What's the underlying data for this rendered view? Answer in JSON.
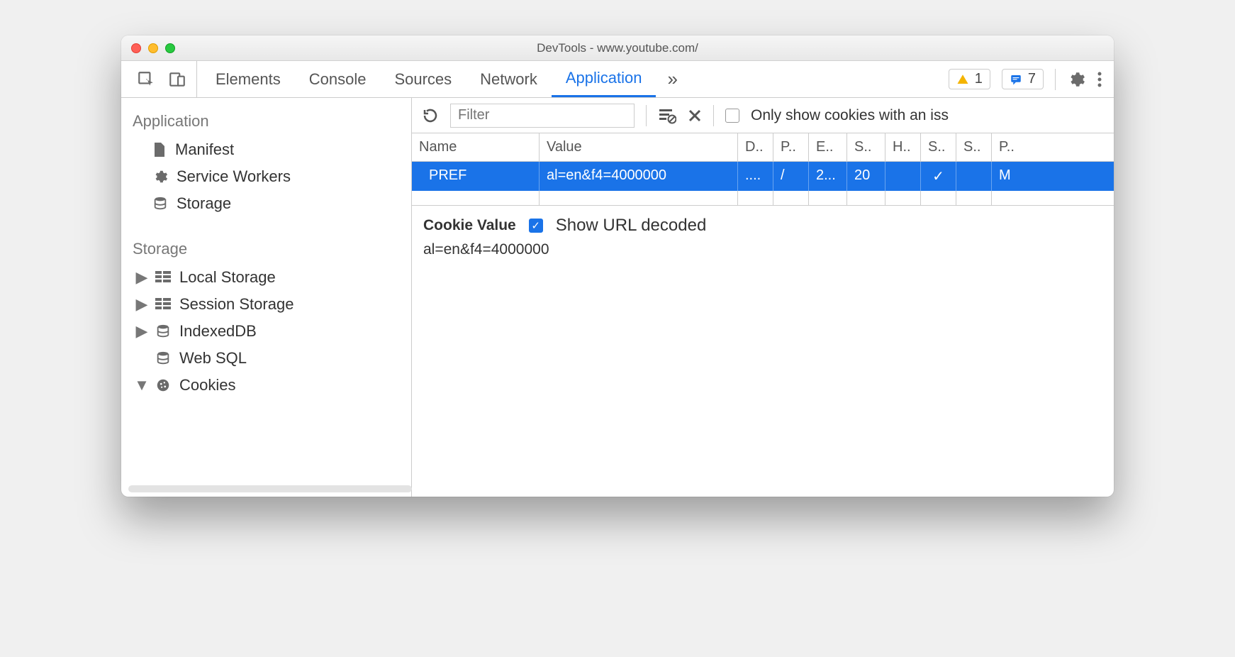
{
  "window": {
    "title": "DevTools - www.youtube.com/"
  },
  "tabs": {
    "items": [
      "Elements",
      "Console",
      "Sources",
      "Network",
      "Application"
    ],
    "active": "Application"
  },
  "counters": {
    "warnings": "1",
    "messages": "7"
  },
  "toolbar": {
    "filter_placeholder": "Filter",
    "only_issue_label": "Only show cookies with an iss"
  },
  "sidebar": {
    "sections": [
      {
        "title": "Application",
        "items": [
          {
            "label": "Manifest",
            "icon": "file"
          },
          {
            "label": "Service Workers",
            "icon": "gear"
          },
          {
            "label": "Storage",
            "icon": "db"
          }
        ]
      },
      {
        "title": "Storage",
        "items": [
          {
            "label": "Local Storage",
            "icon": "grid",
            "caret": "right"
          },
          {
            "label": "Session Storage",
            "icon": "grid",
            "caret": "right"
          },
          {
            "label": "IndexedDB",
            "icon": "db",
            "caret": "right"
          },
          {
            "label": "Web SQL",
            "icon": "db"
          },
          {
            "label": "Cookies",
            "icon": "cookie",
            "caret": "down"
          }
        ]
      }
    ]
  },
  "columns": [
    "Name",
    "Value",
    "D..",
    "P..",
    "E..",
    "S..",
    "H..",
    "S..",
    "S..",
    "P.."
  ],
  "rows": [
    {
      "name": "PREF",
      "value": "al=en&f4=4000000",
      "d": "....",
      "p": "/",
      "e": "2...",
      "s": "20",
      "h": "",
      "s2": "✓",
      "s3": "",
      "p2": "M"
    }
  ],
  "detail": {
    "heading": "Cookie Value",
    "decoded_label": "Show URL decoded",
    "decoded_checked": true,
    "value": "al=en&f4=4000000"
  }
}
